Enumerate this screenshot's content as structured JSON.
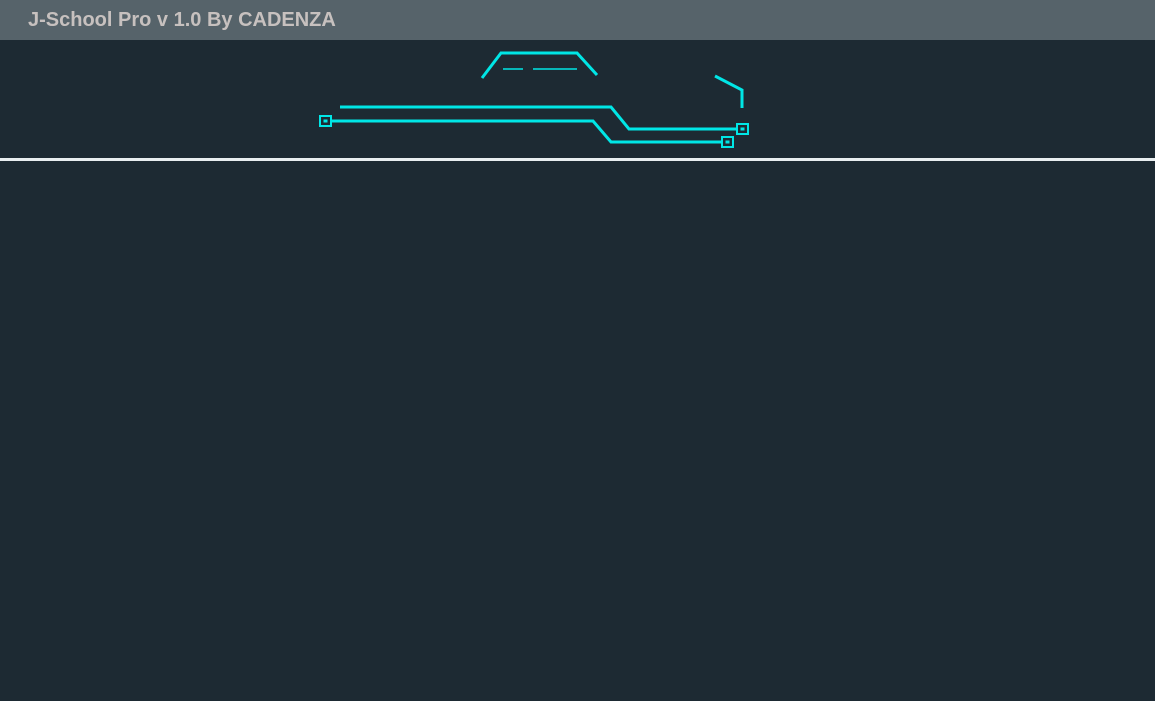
{
  "window": {
    "title": "J-School Pro v 1.0 By CADENZA"
  },
  "colors": {
    "titlebar_bg": "#56636a",
    "title_text": "#c7c1bf",
    "background": "#1d2a33",
    "accent": "#00e6e6",
    "divider": "#e8eef0"
  },
  "icons": [
    "circuit-decoration",
    "connector-node-icon"
  ]
}
